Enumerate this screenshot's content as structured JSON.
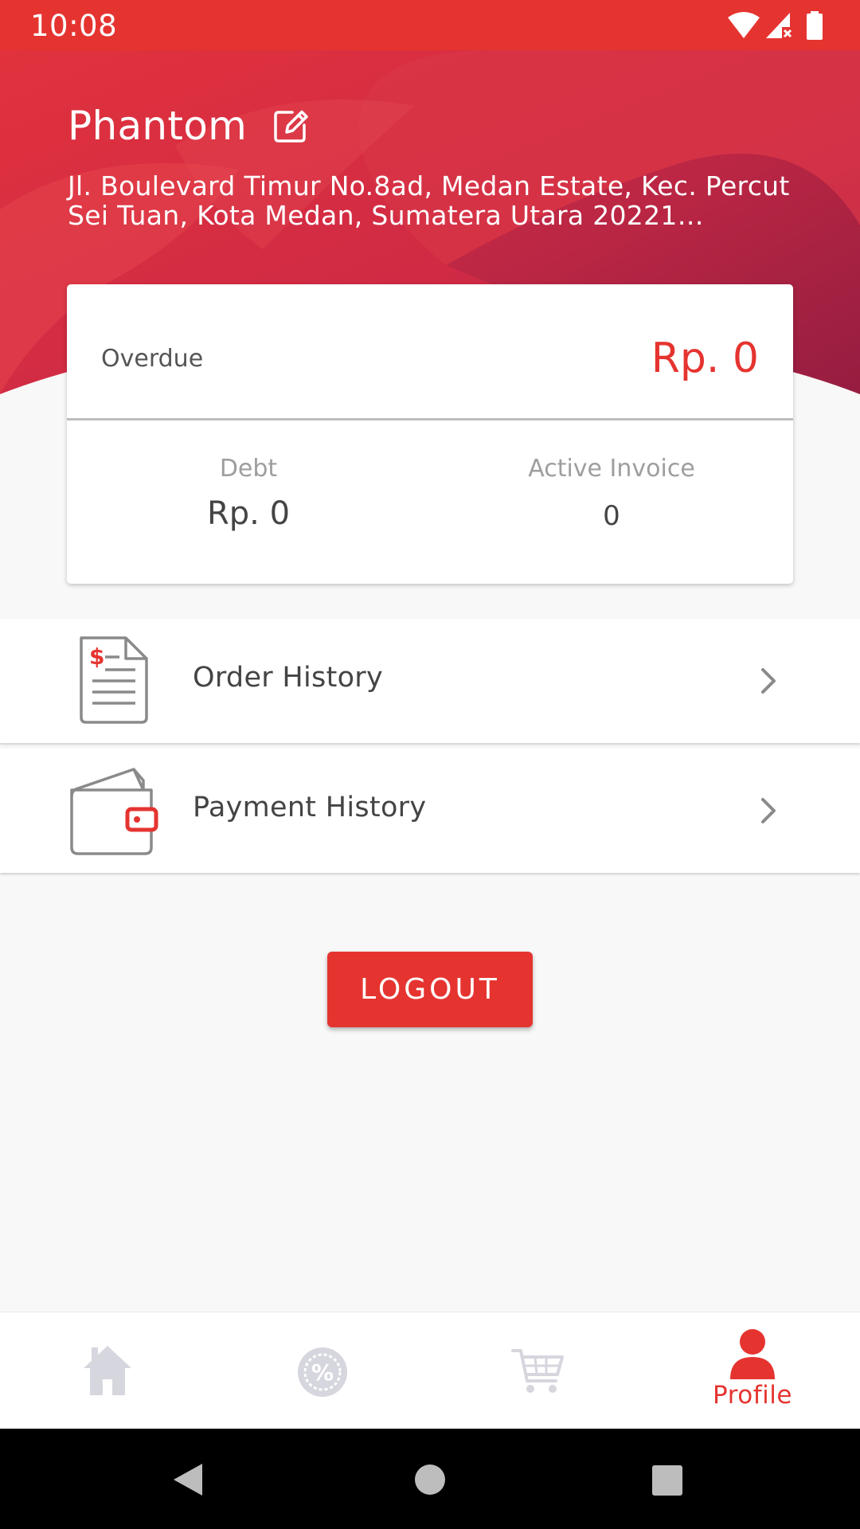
{
  "status_bar": {
    "time": "10:08",
    "icons": [
      "wifi-icon",
      "cellular-signal-icon",
      "battery-icon"
    ]
  },
  "profile": {
    "name": "Phantom",
    "address": "Jl. Boulevard Timur No.8ad, Medan Estate, Kec. Percut Sei Tuan, Kota Medan, Sumatera Utara 20221…"
  },
  "summary": {
    "overdue_label": "Overdue",
    "overdue_value": "Rp. 0",
    "debt_label": "Debt",
    "debt_value": "Rp. 0",
    "active_invoice_label": "Active Invoice",
    "active_invoice_value": "0"
  },
  "menu": {
    "items": [
      {
        "label": "Order History",
        "icon": "invoice-document-icon"
      },
      {
        "label": "Payment History",
        "icon": "wallet-icon"
      }
    ]
  },
  "logout_label": "LOGOUT",
  "bottom_nav": {
    "items": [
      {
        "icon": "home-icon",
        "active": false
      },
      {
        "icon": "promo-icon",
        "active": false
      },
      {
        "icon": "cart-icon",
        "active": false
      },
      {
        "icon": "profile-icon",
        "active": true,
        "label": "Profile"
      }
    ]
  },
  "colors": {
    "primary": "#e53430",
    "header_dark": "#b01c3f",
    "inactive_icon": "#d6d6de",
    "background": "#f8f8f8"
  }
}
